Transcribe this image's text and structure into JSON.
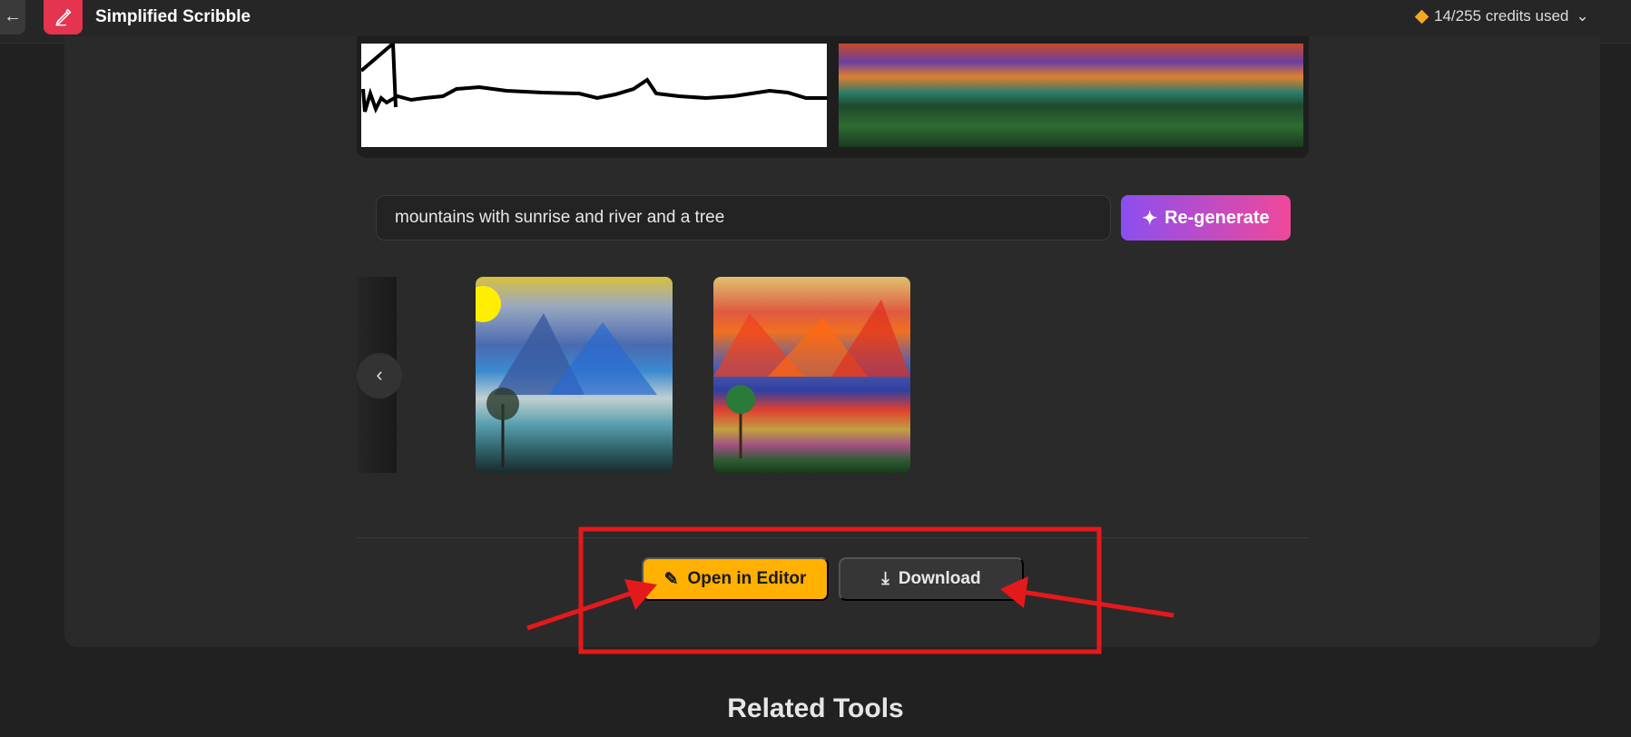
{
  "header": {
    "back_icon": "arrow-left-icon",
    "logo_icon": "pen-icon",
    "title": "Simplified Scribble",
    "credits_icon": "diamond-icon",
    "credits": "14/255 credits used",
    "credits_chevron": "chevron-down-icon"
  },
  "prompt": {
    "value": "mountains with sunrise and river and a tree"
  },
  "regenerate": {
    "icon": "sparkles-icon",
    "label": "Re-generate"
  },
  "carousel": {
    "prev_icon": "chevron-left-icon",
    "prev": "‹"
  },
  "actions": {
    "open_editor": {
      "icon": "pencil-icon",
      "label": "Open in Editor"
    },
    "download": {
      "icon": "download-icon",
      "label": "Download"
    }
  },
  "related": {
    "title": "Related Tools"
  },
  "colors": {
    "accent_yellow": "#ffb000",
    "brand_red": "#e4344f",
    "annotation_red": "#e4191c",
    "regen_from": "#8b4ff0",
    "regen_to": "#f0489a"
  }
}
